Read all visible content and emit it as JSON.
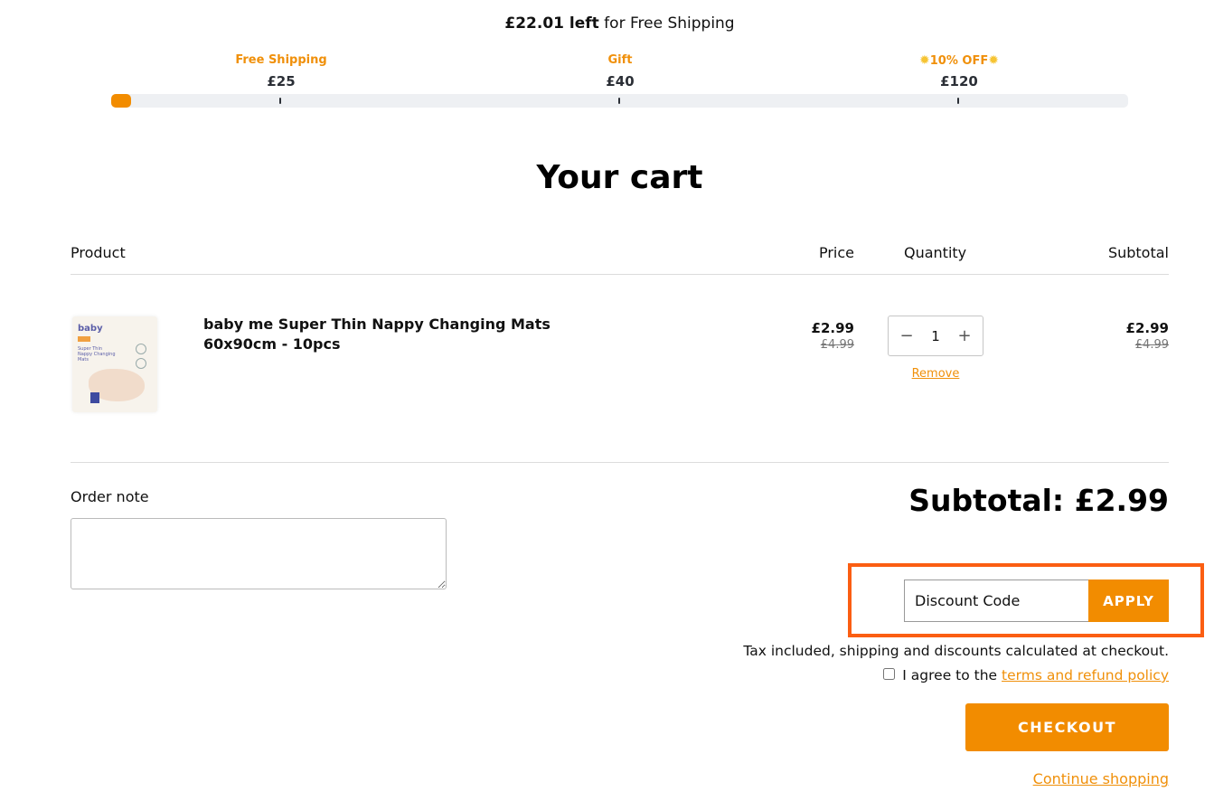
{
  "shipping_bar": {
    "amount_left": "£22.01 left",
    "message_suffix": " for Free Shipping",
    "progress_value": 2.99,
    "progress_max": 120,
    "fill_color": "#f28c00",
    "milestones": [
      {
        "label": "Free Shipping",
        "amount": "£25",
        "value": 25
      },
      {
        "label": "Gift",
        "amount": "£40",
        "value": 40
      },
      {
        "label": "10% OFF",
        "amount": "£120",
        "value": 120,
        "icon": "sun-icon"
      }
    ]
  },
  "page": {
    "title": "Your cart"
  },
  "table": {
    "headers": {
      "product": "Product",
      "price": "Price",
      "quantity": "Quantity",
      "subtotal": "Subtotal"
    },
    "items": [
      {
        "name": "baby me Super Thin Nappy Changing Mats 60x90cm - 10pcs",
        "image": "nappy-changing-mats-product-image",
        "price": "£2.99",
        "compare_price": "£4.99",
        "quantity": "1",
        "subtotal": "£2.99",
        "compare_subtotal": "£4.99",
        "remove_label": "Remove"
      }
    ]
  },
  "order_note": {
    "label": "Order note",
    "value": ""
  },
  "summary": {
    "subtotal_text": "Subtotal: £2.99",
    "discount_placeholder": "Discount Code",
    "apply_label": "APPLY",
    "tax_note": "Tax included, shipping and discounts calculated at checkout.",
    "agree_prefix": "I agree to the ",
    "agree_link": "terms and refund policy",
    "agree_checked": false,
    "checkout_label": "CHECKOUT",
    "continue_label": "Continue shopping"
  },
  "colors": {
    "accent": "#f28c00",
    "link": "#f0900a",
    "highlight_border": "#fb5e12"
  }
}
